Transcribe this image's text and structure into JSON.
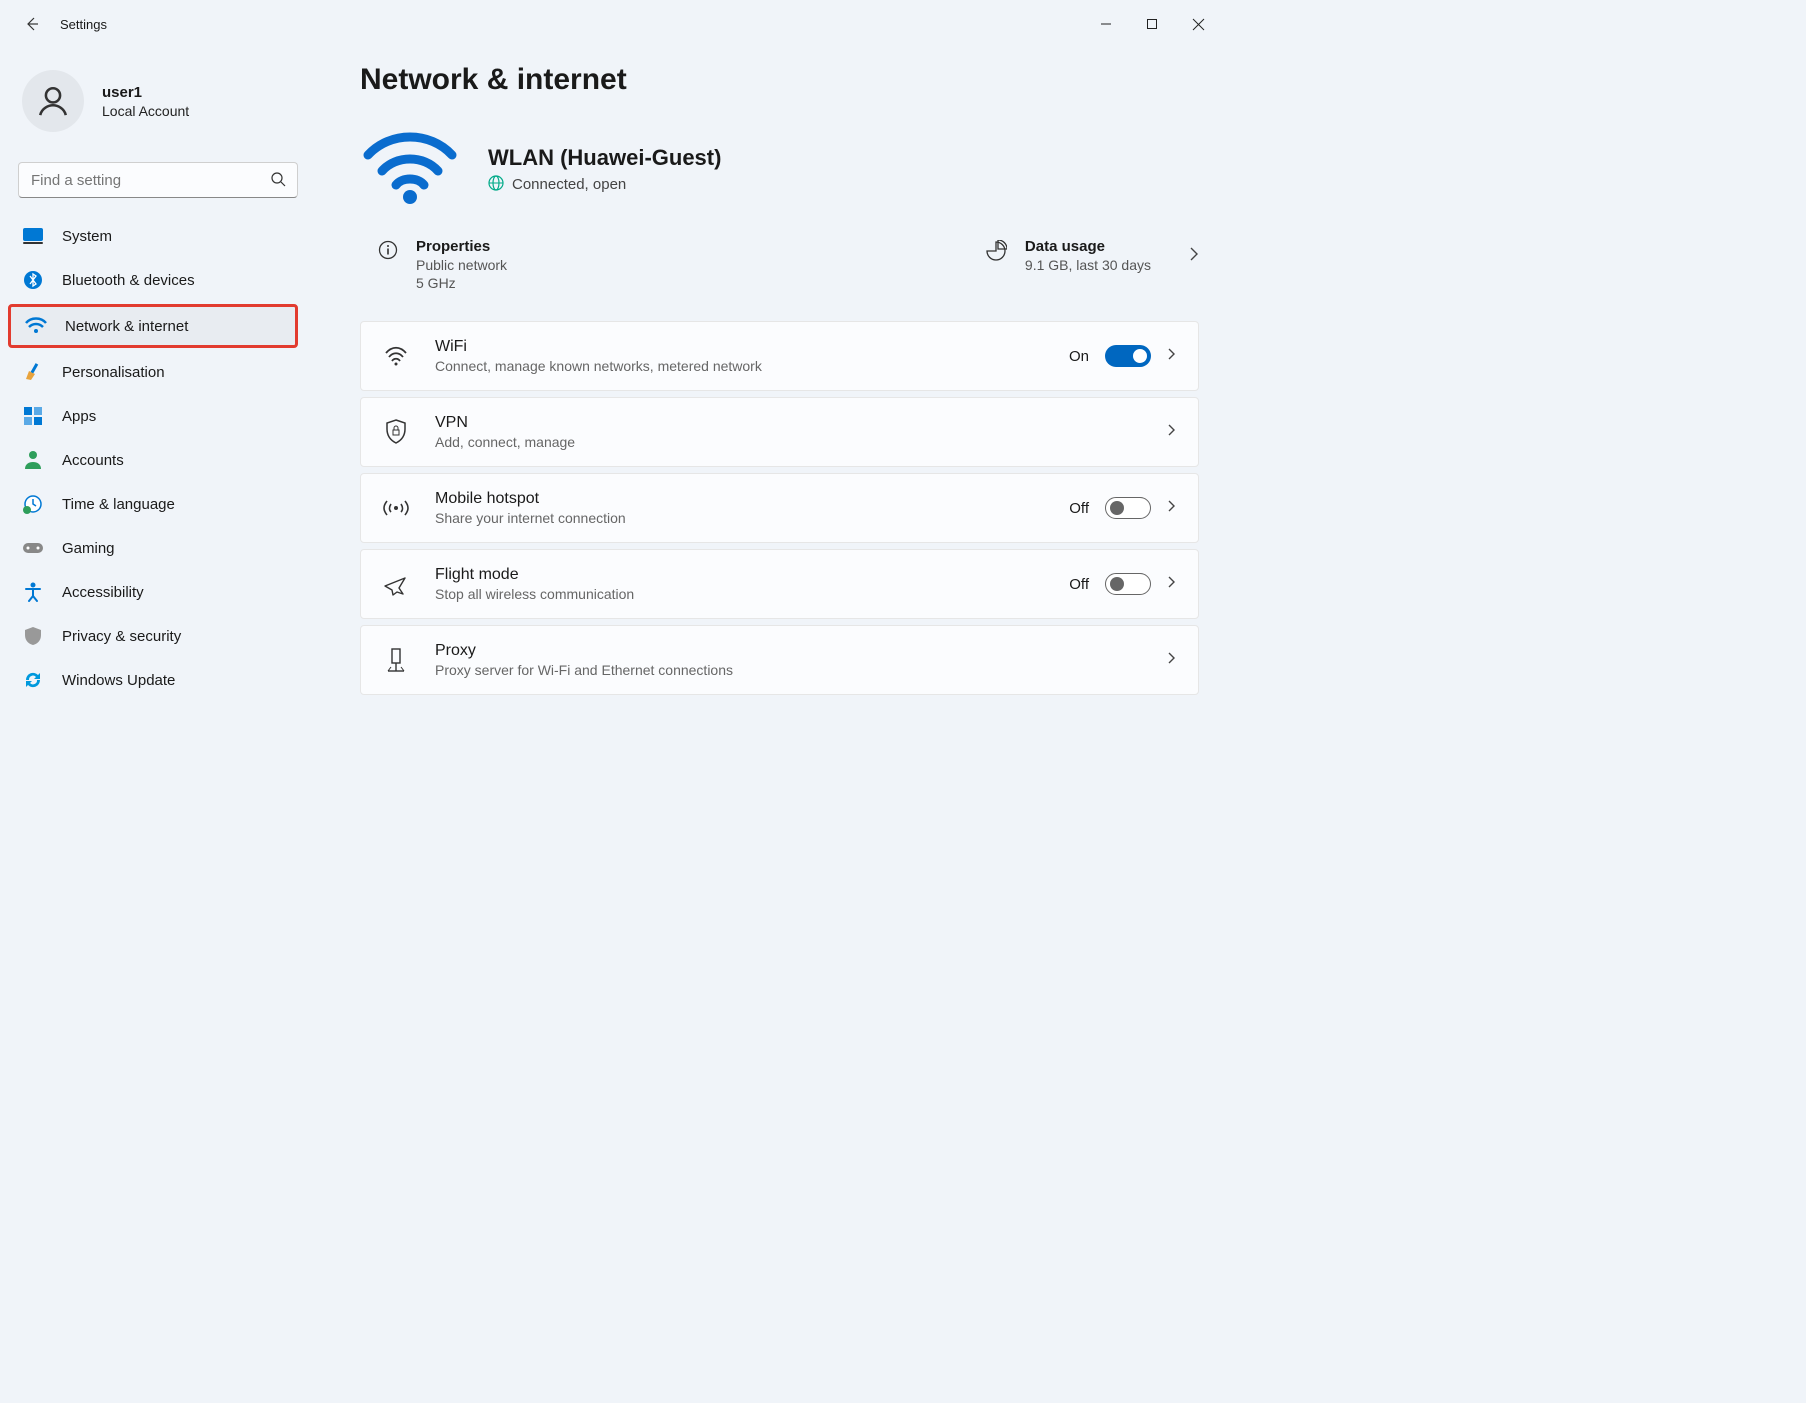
{
  "app": {
    "title": "Settings"
  },
  "user": {
    "name": "user1",
    "sub": "Local Account"
  },
  "search": {
    "placeholder": "Find a setting"
  },
  "nav": [
    {
      "label": "System",
      "icon": "system"
    },
    {
      "label": "Bluetooth & devices",
      "icon": "bluetooth"
    },
    {
      "label": "Network & internet",
      "icon": "wifi",
      "active": true
    },
    {
      "label": "Personalisation",
      "icon": "brush"
    },
    {
      "label": "Apps",
      "icon": "apps"
    },
    {
      "label": "Accounts",
      "icon": "person"
    },
    {
      "label": "Time & language",
      "icon": "clock"
    },
    {
      "label": "Gaming",
      "icon": "gaming"
    },
    {
      "label": "Accessibility",
      "icon": "accessibility"
    },
    {
      "label": "Privacy & security",
      "icon": "shield"
    },
    {
      "label": "Windows Update",
      "icon": "update"
    }
  ],
  "page": {
    "title": "Network & internet",
    "hero": {
      "title": "WLAN (Huawei-Guest)",
      "status": "Connected, open"
    },
    "summary": {
      "properties": {
        "title": "Properties",
        "line1": "Public network",
        "line2": "5 GHz"
      },
      "usage": {
        "title": "Data usage",
        "line1": "9.1 GB, last 30 days"
      }
    },
    "cards": [
      {
        "id": "wifi",
        "title": "WiFi",
        "sub": "Connect, manage known networks, metered network",
        "toggle": "On",
        "icon": "wifi"
      },
      {
        "id": "vpn",
        "title": "VPN",
        "sub": "Add, connect, manage",
        "icon": "shield-lock"
      },
      {
        "id": "hotspot",
        "title": "Mobile hotspot",
        "sub": "Share your internet connection",
        "toggle": "Off",
        "icon": "hotspot"
      },
      {
        "id": "flight",
        "title": "Flight mode",
        "sub": "Stop all wireless communication",
        "toggle": "Off",
        "icon": "plane"
      },
      {
        "id": "proxy",
        "title": "Proxy",
        "sub": "Proxy server for Wi-Fi and Ethernet connections",
        "icon": "proxy"
      }
    ]
  }
}
